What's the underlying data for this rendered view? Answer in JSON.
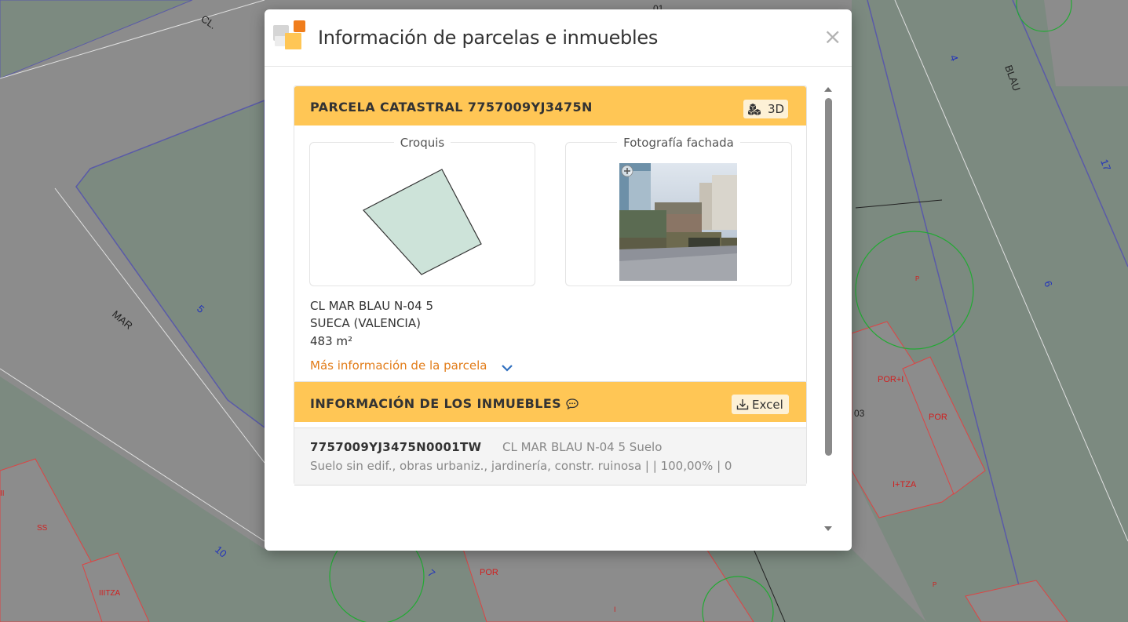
{
  "map": {
    "labels": {
      "cl": "CL.",
      "mar": "MAR",
      "blau": "BLAU",
      "n01": "01",
      "n4": "4",
      "n17": "17",
      "n6": "6",
      "n5": "5",
      "n03": "03",
      "n10": "10",
      "n7": "7",
      "por_plus_i": "POR+I",
      "por1": "POR",
      "por2": "POR",
      "itza": "I+TZA",
      "ss": "SS",
      "iitza": "IIITZA",
      "ii": "II",
      "p1": "P",
      "p2": "P",
      "i": "I"
    }
  },
  "modal": {
    "title": "Información de parcelas e inmuebles",
    "close_symbol": "×"
  },
  "parcela": {
    "header": "PARCELA CATASTRAL 7757009YJ3475N",
    "btn_3d": "3D",
    "croquis_label": "Croquis",
    "foto_label": "Fotografía fachada",
    "address_line1": "CL MAR BLAU N-04 5",
    "address_line2": "SUECA (VALENCIA)",
    "area": "483 m²",
    "more_info": "Más información de la parcela"
  },
  "inmuebles": {
    "header": "INFORMACIÓN DE LOS INMUEBLES",
    "btn_excel": "Excel",
    "rows": [
      {
        "ref": "7757009YJ3475N0001TW",
        "address": "CL MAR BLAU N-04 5 Suelo",
        "desc": "Suelo sin edif., obras urbaniz., jardinería, constr. ruinosa | | 100,00% | 0"
      }
    ]
  },
  "colors": {
    "accent_header": "#ffc655",
    "link": "#e27c18",
    "map_block": "#7c8a80",
    "map_street": "#8c8c8c",
    "parcel_fill": "#cde3d9"
  },
  "icons": {
    "logo": "catastro-logo-icon",
    "cube": "cubes-3d-icon",
    "download": "download-icon",
    "chat": "comment-icon",
    "chevron": "chevron-down-icon",
    "zoom": "zoom-plus-icon"
  }
}
